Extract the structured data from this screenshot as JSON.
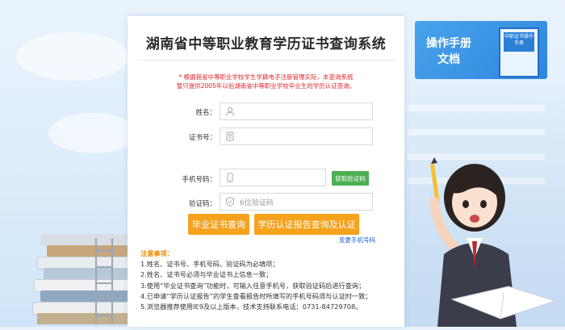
{
  "page": {
    "title": "湖南省中等职业教育学历证书查询系统",
    "notice_line1": "* 根据我省中等职业学校学生学籍电子注册管理实际，本查询系统",
    "notice_line2": "暂只提供2005年以后湖南省中等职业学校毕业生的学历认证查询。"
  },
  "form": {
    "name_label": "姓名：",
    "cert_label": "证书号：",
    "phone_label": "手机号码：",
    "code_label": "验证码：",
    "name_value": "",
    "cert_value": "",
    "phone_value": "",
    "code_placeholder": "6位验证码",
    "sms_button": "获取验证码",
    "search_button": "毕业证书查询",
    "report_button": "学历认证报告查询及认证",
    "change_phone_link": "变更手机号码"
  },
  "tips": {
    "title": "注意事项：",
    "items": [
      "1.姓名、证书号、手机号码、验证码为必填项；",
      "2.姓名、证书号必须与毕业证书上信息一致；",
      "3.使用“毕业证书查询”功能时，可输入任意手机号，获取验证码后进行查询；",
      "4.已申请“学历认证报告”的学生查看报告时所填写的手机号码须与认证时一致；",
      "5.浏览器推荐使用IE9及以上版本，技术支持联系电话：0731-84729708。"
    ]
  },
  "manual": {
    "line1": "操作手册",
    "line2": "文档",
    "cover_text": "中职证书操作手册"
  },
  "colors": {
    "accent_orange": "#f5a21c",
    "sms_green": "#4caf50",
    "notice_red": "#e0242a",
    "manual_blue": "#2f86dd"
  },
  "icons": [
    "user-icon",
    "id-card-icon",
    "phone-icon",
    "shield-icon"
  ]
}
